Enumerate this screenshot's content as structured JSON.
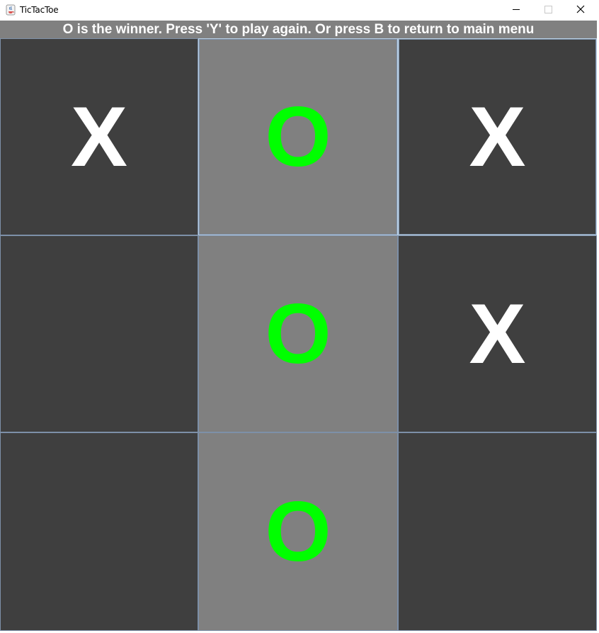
{
  "window": {
    "title": "TicTacToe",
    "icon": "java-cup-icon"
  },
  "status": {
    "message": "O is the winner. Press 'Y' to play again. Or press B to return to main menu"
  },
  "board": {
    "cells": [
      {
        "mark": "X",
        "style": "dark"
      },
      {
        "mark": "O",
        "style": "light"
      },
      {
        "mark": "X",
        "style": "dark"
      },
      {
        "mark": "",
        "style": "dark"
      },
      {
        "mark": "O",
        "style": "light"
      },
      {
        "mark": "X",
        "style": "dark"
      },
      {
        "mark": "",
        "style": "dark"
      },
      {
        "mark": "O",
        "style": "light"
      },
      {
        "mark": "",
        "style": "dark"
      }
    ]
  },
  "colors": {
    "x_mark": "#ffffff",
    "o_mark": "#00ff00",
    "cell_dark": "#3f3f3f",
    "cell_win": "#808080",
    "status_bg": "#808080"
  }
}
